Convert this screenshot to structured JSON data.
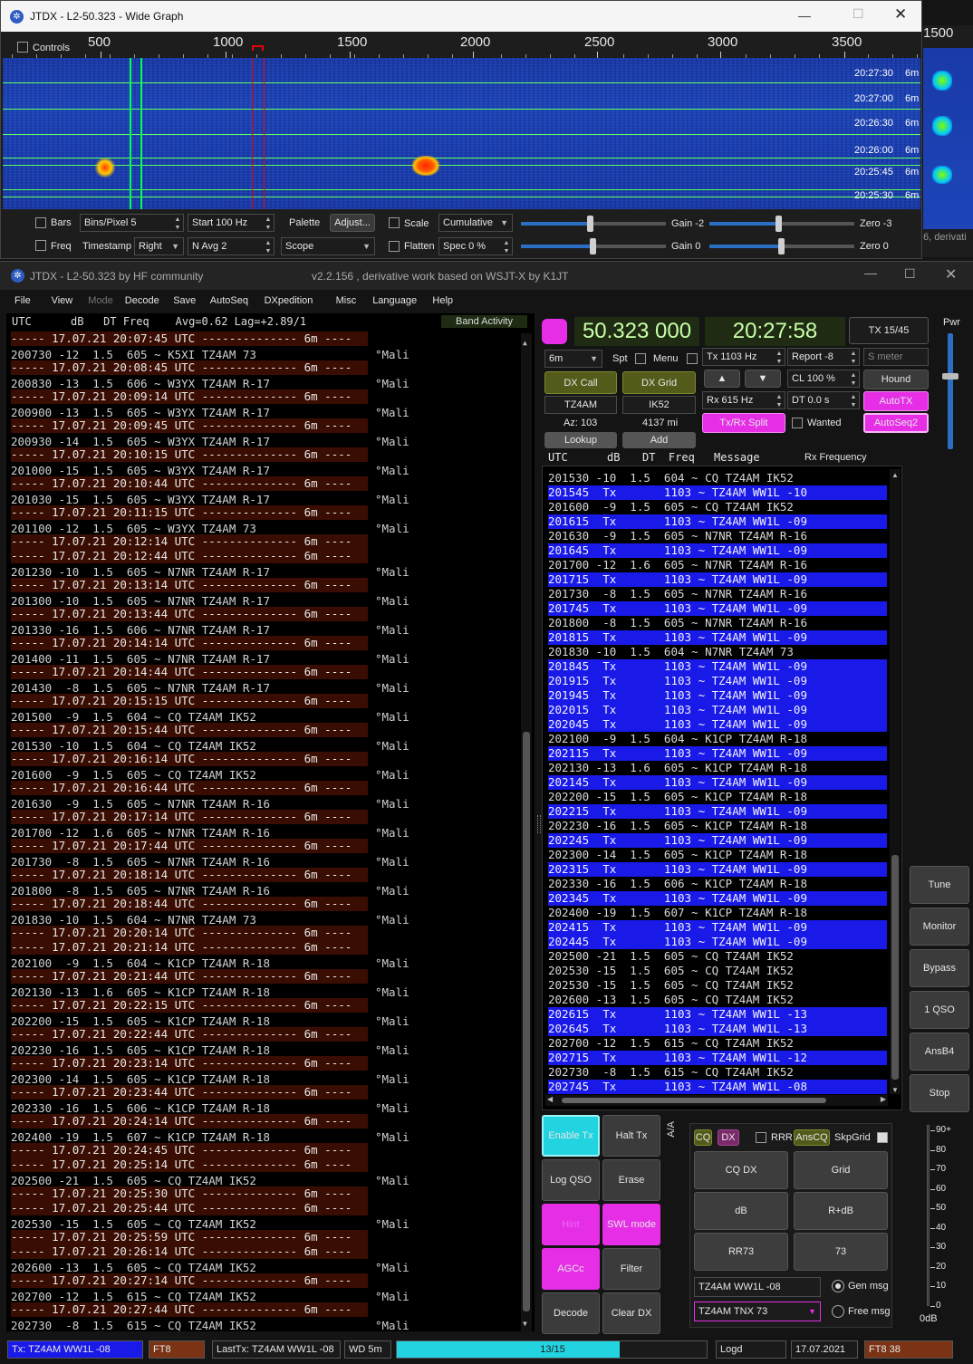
{
  "wg": {
    "title": "JTDX - L2-50.323 - Wide Graph",
    "controls": "Controls",
    "freq_ticks": [
      "500",
      "1000",
      "1500",
      "2000",
      "2500",
      "3000",
      "3500"
    ],
    "side_tick": "1500",
    "time_labels": [
      {
        "t": "20:27:30",
        "b": "6m"
      },
      {
        "t": "20:27:00",
        "b": "6m"
      },
      {
        "t": "20:26:30",
        "b": "6m"
      },
      {
        "t": "20:26:00",
        "b": "6m"
      },
      {
        "t": "20:25:45",
        "b": "6m"
      },
      {
        "t": "20:25:30",
        "b": "6m"
      }
    ],
    "bars": "Bars",
    "freq": "Freq",
    "bins": "Bins/Pixel  5",
    "start": "Start 100 Hz",
    "navg": "N Avg  2",
    "timestamp": "Timestamp",
    "ts_value": "Right",
    "palette": "Palette",
    "adjust": "Adjust...",
    "scope": "Scope",
    "scale": "Scale",
    "cumulative": "Cumulative",
    "flatten": "Flatten",
    "spec": "Spec 0 %",
    "gain1": "Gain -2",
    "gain2": "Gain 0",
    "zero1": "Zero -3",
    "zero2": "Zero 0",
    "behind_text": "6, derivati"
  },
  "main": {
    "title": "JTDX - L2-50.323  by HF community",
    "subtitle": "v2.2.156 , derivative work based on WSJT-X by K1JT",
    "menu": [
      "File",
      "View",
      "Mode",
      "Decode",
      "Save",
      "AutoSeq",
      "DXpedition",
      "Misc",
      "Language",
      "Help"
    ]
  },
  "left": {
    "header": "UTC      dB   DT Freq    Avg=0.62 Lag=+2.89/1",
    "band_activity": "Band Activity",
    "rows": [
      {
        "k": "s",
        "t": "----- 17.07.21 20:07:45 UTC -------------- 6m ----"
      },
      {
        "k": "d",
        "t": "200730 -12  1.5  605 ~ K5XI TZ4AM 73",
        "c": "°Mali"
      },
      {
        "k": "s",
        "t": "----- 17.07.21 20:08:45 UTC -------------- 6m ----"
      },
      {
        "k": "d",
        "t": "200830 -13  1.5  606 ~ W3YX TZ4AM R-17",
        "c": "°Mali"
      },
      {
        "k": "s",
        "t": "----- 17.07.21 20:09:14 UTC -------------- 6m ----"
      },
      {
        "k": "d",
        "t": "200900 -13  1.5  605 ~ W3YX TZ4AM R-17",
        "c": "°Mali"
      },
      {
        "k": "s",
        "t": "----- 17.07.21 20:09:45 UTC -------------- 6m ----"
      },
      {
        "k": "d",
        "t": "200930 -14  1.5  605 ~ W3YX TZ4AM R-17",
        "c": "°Mali"
      },
      {
        "k": "s",
        "t": "----- 17.07.21 20:10:15 UTC -------------- 6m ----"
      },
      {
        "k": "d",
        "t": "201000 -15  1.5  605 ~ W3YX TZ4AM R-17",
        "c": "°Mali"
      },
      {
        "k": "s",
        "t": "----- 17.07.21 20:10:44 UTC -------------- 6m ----"
      },
      {
        "k": "d",
        "t": "201030 -15  1.5  605 ~ W3YX TZ4AM R-17",
        "c": "°Mali"
      },
      {
        "k": "s",
        "t": "----- 17.07.21 20:11:15 UTC -------------- 6m ----"
      },
      {
        "k": "d",
        "t": "201100 -12  1.5  605 ~ W3YX TZ4AM 73",
        "c": "°Mali"
      },
      {
        "k": "s",
        "t": "----- 17.07.21 20:12:14 UTC -------------- 6m ----"
      },
      {
        "k": "s",
        "t": "----- 17.07.21 20:12:44 UTC -------------- 6m ----"
      },
      {
        "k": "d",
        "t": "201230 -10  1.5  605 ~ N7NR TZ4AM R-17",
        "c": "°Mali"
      },
      {
        "k": "s",
        "t": "----- 17.07.21 20:13:14 UTC -------------- 6m ----"
      },
      {
        "k": "d",
        "t": "201300 -10  1.5  605 ~ N7NR TZ4AM R-17",
        "c": "°Mali"
      },
      {
        "k": "s",
        "t": "----- 17.07.21 20:13:44 UTC -------------- 6m ----"
      },
      {
        "k": "d",
        "t": "201330 -16  1.5  606 ~ N7NR TZ4AM R-17",
        "c": "°Mali"
      },
      {
        "k": "s",
        "t": "----- 17.07.21 20:14:14 UTC -------------- 6m ----"
      },
      {
        "k": "d",
        "t": "201400 -11  1.5  605 ~ N7NR TZ4AM R-17",
        "c": "°Mali"
      },
      {
        "k": "s",
        "t": "----- 17.07.21 20:14:44 UTC -------------- 6m ----"
      },
      {
        "k": "d",
        "t": "201430  -8  1.5  605 ~ N7NR TZ4AM R-17",
        "c": "°Mali"
      },
      {
        "k": "s",
        "t": "----- 17.07.21 20:15:15 UTC -------------- 6m ----"
      },
      {
        "k": "d",
        "t": "201500  -9  1.5  604 ~ CQ TZ4AM IK52",
        "c": "°Mali"
      },
      {
        "k": "s",
        "t": "----- 17.07.21 20:15:44 UTC -------------- 6m ----"
      },
      {
        "k": "d",
        "t": "201530 -10  1.5  604 ~ CQ TZ4AM IK52",
        "c": "°Mali"
      },
      {
        "k": "s",
        "t": "----- 17.07.21 20:16:14 UTC -------------- 6m ----"
      },
      {
        "k": "d",
        "t": "201600  -9  1.5  605 ~ CQ TZ4AM IK52",
        "c": "°Mali"
      },
      {
        "k": "s",
        "t": "----- 17.07.21 20:16:44 UTC -------------- 6m ----"
      },
      {
        "k": "d",
        "t": "201630  -9  1.5  605 ~ N7NR TZ4AM R-16",
        "c": "°Mali"
      },
      {
        "k": "s",
        "t": "----- 17.07.21 20:17:14 UTC -------------- 6m ----"
      },
      {
        "k": "d",
        "t": "201700 -12  1.6  605 ~ N7NR TZ4AM R-16",
        "c": "°Mali"
      },
      {
        "k": "s",
        "t": "----- 17.07.21 20:17:44 UTC -------------- 6m ----"
      },
      {
        "k": "d",
        "t": "201730  -8  1.5  605 ~ N7NR TZ4AM R-16",
        "c": "°Mali"
      },
      {
        "k": "s",
        "t": "----- 17.07.21 20:18:14 UTC -------------- 6m ----"
      },
      {
        "k": "d",
        "t": "201800  -8  1.5  605 ~ N7NR TZ4AM R-16",
        "c": "°Mali"
      },
      {
        "k": "s",
        "t": "----- 17.07.21 20:18:44 UTC -------------- 6m ----"
      },
      {
        "k": "d",
        "t": "201830 -10  1.5  604 ~ N7NR TZ4AM 73",
        "c": "°Mali"
      },
      {
        "k": "s",
        "t": "----- 17.07.21 20:20:14 UTC -------------- 6m ----"
      },
      {
        "k": "s",
        "t": "----- 17.07.21 20:21:14 UTC -------------- 6m ----"
      },
      {
        "k": "d",
        "t": "202100  -9  1.5  604 ~ K1CP TZ4AM R-18",
        "c": "°Mali"
      },
      {
        "k": "s",
        "t": "----- 17.07.21 20:21:44 UTC -------------- 6m ----"
      },
      {
        "k": "d",
        "t": "202130 -13  1.6  605 ~ K1CP TZ4AM R-18",
        "c": "°Mali"
      },
      {
        "k": "s",
        "t": "----- 17.07.21 20:22:15 UTC -------------- 6m ----"
      },
      {
        "k": "d",
        "t": "202200 -15  1.5  605 ~ K1CP TZ4AM R-18",
        "c": "°Mali"
      },
      {
        "k": "s",
        "t": "----- 17.07.21 20:22:44 UTC -------------- 6m ----"
      },
      {
        "k": "d",
        "t": "202230 -16  1.5  605 ~ K1CP TZ4AM R-18",
        "c": "°Mali"
      },
      {
        "k": "s",
        "t": "----- 17.07.21 20:23:14 UTC -------------- 6m ----"
      },
      {
        "k": "d",
        "t": "202300 -14  1.5  605 ~ K1CP TZ4AM R-18",
        "c": "°Mali"
      },
      {
        "k": "s",
        "t": "----- 17.07.21 20:23:44 UTC -------------- 6m ----"
      },
      {
        "k": "d",
        "t": "202330 -16  1.5  606 ~ K1CP TZ4AM R-18",
        "c": "°Mali"
      },
      {
        "k": "s",
        "t": "----- 17.07.21 20:24:14 UTC -------------- 6m ----"
      },
      {
        "k": "d",
        "t": "202400 -19  1.5  607 ~ K1CP TZ4AM R-18",
        "c": "°Mali"
      },
      {
        "k": "s",
        "t": "----- 17.07.21 20:24:45 UTC -------------- 6m ----"
      },
      {
        "k": "s",
        "t": "----- 17.07.21 20:25:14 UTC -------------- 6m ----"
      },
      {
        "k": "d",
        "t": "202500 -21  1.5  605 ~ CQ TZ4AM IK52",
        "c": "°Mali"
      },
      {
        "k": "s",
        "t": "----- 17.07.21 20:25:30 UTC -------------- 6m ----"
      },
      {
        "k": "s",
        "t": "----- 17.07.21 20:25:44 UTC -------------- 6m ----"
      },
      {
        "k": "d",
        "t": "202530 -15  1.5  605 ~ CQ TZ4AM IK52",
        "c": "°Mali"
      },
      {
        "k": "s",
        "t": "----- 17.07.21 20:25:59 UTC -------------- 6m ----"
      },
      {
        "k": "s",
        "t": "----- 17.07.21 20:26:14 UTC -------------- 6m ----"
      },
      {
        "k": "d",
        "t": "202600 -13  1.5  605 ~ CQ TZ4AM IK52",
        "c": "°Mali"
      },
      {
        "k": "s",
        "t": "----- 17.07.21 20:27:14 UTC -------------- 6m ----"
      },
      {
        "k": "d",
        "t": "202700 -12  1.5  615 ~ CQ TZ4AM IK52",
        "c": "°Mali"
      },
      {
        "k": "s",
        "t": "----- 17.07.21 20:27:44 UTC -------------- 6m ----"
      },
      {
        "k": "d",
        "t": "202730  -8  1.5  615 ~ CQ TZ4AM IK52",
        "c": "°Mali"
      }
    ]
  },
  "ctrl": {
    "freq": "50.323 000",
    "time": "20:27:58",
    "tx_slot": "TX 15/45",
    "pwr": "Pwr",
    "band": "6m",
    "spt": "Spt",
    "menu": "Menu",
    "tx_hz": "Tx  1103  Hz",
    "report": "Report -8",
    "smeter": "S meter",
    "dx_call_btn": "DX Call",
    "dx_grid_btn": "DX Grid",
    "cl": "CL  100 %",
    "hound": "Hound",
    "dx_call": "TZ4AM",
    "dx_grid": "IK52",
    "rx_hz": "Rx  615  Hz",
    "dt": "DT 0.0 s",
    "autotx": "AutoTX",
    "az": "Az: 103",
    "dist": "4137 mi",
    "txrx_split": "Tx/Rx Split",
    "wanted": "Wanted",
    "autoseq2": "AutoSeq2",
    "lookup": "Lookup",
    "add": "Add"
  },
  "right": {
    "header_utc": "UTC",
    "header_db": "dB",
    "header_dt": "DT  Freq",
    "header_msg": "Message",
    "header_rx": "Rx Frequency",
    "rows": [
      {
        "tx": false,
        "t": "201530 -10  1.5  604 ~ CQ TZ4AM IK52"
      },
      {
        "tx": true,
        "t": "201545  Tx       1103 ~ TZ4AM WW1L -10"
      },
      {
        "tx": false,
        "t": "201600  -9  1.5  605 ~ CQ TZ4AM IK52"
      },
      {
        "tx": true,
        "t": "201615  Tx       1103 ~ TZ4AM WW1L -09"
      },
      {
        "tx": false,
        "t": "201630  -9  1.5  605 ~ N7NR TZ4AM R-16"
      },
      {
        "tx": true,
        "t": "201645  Tx       1103 ~ TZ4AM WW1L -09"
      },
      {
        "tx": false,
        "t": "201700 -12  1.6  605 ~ N7NR TZ4AM R-16"
      },
      {
        "tx": true,
        "t": "201715  Tx       1103 ~ TZ4AM WW1L -09"
      },
      {
        "tx": false,
        "t": "201730  -8  1.5  605 ~ N7NR TZ4AM R-16"
      },
      {
        "tx": true,
        "t": "201745  Tx       1103 ~ TZ4AM WW1L -09"
      },
      {
        "tx": false,
        "t": "201800  -8  1.5  605 ~ N7NR TZ4AM R-16"
      },
      {
        "tx": true,
        "t": "201815  Tx       1103 ~ TZ4AM WW1L -09"
      },
      {
        "tx": false,
        "t": "201830 -10  1.5  604 ~ N7NR TZ4AM 73"
      },
      {
        "tx": true,
        "t": "201845  Tx       1103 ~ TZ4AM WW1L -09"
      },
      {
        "tx": true,
        "t": "201915  Tx       1103 ~ TZ4AM WW1L -09"
      },
      {
        "tx": true,
        "t": "201945  Tx       1103 ~ TZ4AM WW1L -09"
      },
      {
        "tx": true,
        "t": "202015  Tx       1103 ~ TZ4AM WW1L -09"
      },
      {
        "tx": true,
        "t": "202045  Tx       1103 ~ TZ4AM WW1L -09"
      },
      {
        "tx": false,
        "t": "202100  -9  1.5  604 ~ K1CP TZ4AM R-18"
      },
      {
        "tx": true,
        "t": "202115  Tx       1103 ~ TZ4AM WW1L -09"
      },
      {
        "tx": false,
        "t": "202130 -13  1.6  605 ~ K1CP TZ4AM R-18"
      },
      {
        "tx": true,
        "t": "202145  Tx       1103 ~ TZ4AM WW1L -09"
      },
      {
        "tx": false,
        "t": "202200 -15  1.5  605 ~ K1CP TZ4AM R-18"
      },
      {
        "tx": true,
        "t": "202215  Tx       1103 ~ TZ4AM WW1L -09"
      },
      {
        "tx": false,
        "t": "202230 -16  1.5  605 ~ K1CP TZ4AM R-18"
      },
      {
        "tx": true,
        "t": "202245  Tx       1103 ~ TZ4AM WW1L -09"
      },
      {
        "tx": false,
        "t": "202300 -14  1.5  605 ~ K1CP TZ4AM R-18"
      },
      {
        "tx": true,
        "t": "202315  Tx       1103 ~ TZ4AM WW1L -09"
      },
      {
        "tx": false,
        "t": "202330 -16  1.5  606 ~ K1CP TZ4AM R-18"
      },
      {
        "tx": true,
        "t": "202345  Tx       1103 ~ TZ4AM WW1L -09"
      },
      {
        "tx": false,
        "t": "202400 -19  1.5  607 ~ K1CP TZ4AM R-18"
      },
      {
        "tx": true,
        "t": "202415  Tx       1103 ~ TZ4AM WW1L -09"
      },
      {
        "tx": true,
        "t": "202445  Tx       1103 ~ TZ4AM WW1L -09"
      },
      {
        "tx": false,
        "t": "202500 -21  1.5  605 ~ CQ TZ4AM IK52"
      },
      {
        "tx": false,
        "t": "202530 -15  1.5  605 ~ CQ TZ4AM IK52"
      },
      {
        "tx": false,
        "t": "202530 -15  1.5  605 ~ CQ TZ4AM IK52"
      },
      {
        "tx": false,
        "t": "202600 -13  1.5  605 ~ CQ TZ4AM IK52"
      },
      {
        "tx": true,
        "t": "202615  Tx       1103 ~ TZ4AM WW1L -13"
      },
      {
        "tx": true,
        "t": "202645  Tx       1103 ~ TZ4AM WW1L -13"
      },
      {
        "tx": false,
        "t": "202700 -12  1.5  615 ~ CQ TZ4AM IK52"
      },
      {
        "tx": true,
        "t": "202715  Tx       1103 ~ TZ4AM WW1L -12"
      },
      {
        "tx": false,
        "t": "202730  -8  1.5  615 ~ CQ TZ4AM IK52"
      },
      {
        "tx": true,
        "t": "202745  Tx       1103 ~ TZ4AM WW1L -08"
      }
    ]
  },
  "side_buttons": [
    "Tune",
    "Monitor",
    "Bypass",
    "1 QSO",
    "AnsB4",
    "Stop"
  ],
  "lower": {
    "enable_tx": "Enable Tx",
    "halt_tx": "Halt Tx",
    "log_qso": "Log QSO",
    "erase": "Erase",
    "hint": "Hint",
    "swl": "SWL mode",
    "agcc": "AGCc",
    "filter": "Filter",
    "decode": "Decode",
    "clear_dx": "Clear DX",
    "arrows": "A/A",
    "cq": "CQ",
    "dx": "DX",
    "rrr": "RRR",
    "anscq": "AnsCQ",
    "skpgrid": "SkpGrid",
    "gen": [
      "CQ DX",
      "Grid",
      "dB",
      "R+dB",
      "RR73",
      "73"
    ],
    "gen_msg_field": "TZ4AM WW1L -08",
    "gen_msg": "Gen msg",
    "free_msg_field": "TZ4AM TNX 73",
    "free_msg": "Free msg",
    "meter_ticks": [
      "90+",
      "80",
      "70",
      "60",
      "50",
      "40",
      "30",
      "20",
      "10",
      "0"
    ],
    "meter_db": "0dB"
  },
  "status": {
    "tx": "Tx: TZ4AM WW1L -08",
    "mode": "FT8",
    "last_tx": "LastTx: TZ4AM WW1L -08",
    "wd": "WD 5m",
    "progress_label": "13/15",
    "progress": 0.72,
    "logd": "Logd",
    "date": "17.07.2021",
    "ft8_38": "FT8  38"
  },
  "colors": {
    "accent_magenta": "#e62ee6",
    "tx_blue": "#1919e8",
    "freq_green": "#1f2c13",
    "dx_olive": "#545b1a",
    "cyan": "#22d3e0",
    "sep_brown": "#3a0d02"
  }
}
